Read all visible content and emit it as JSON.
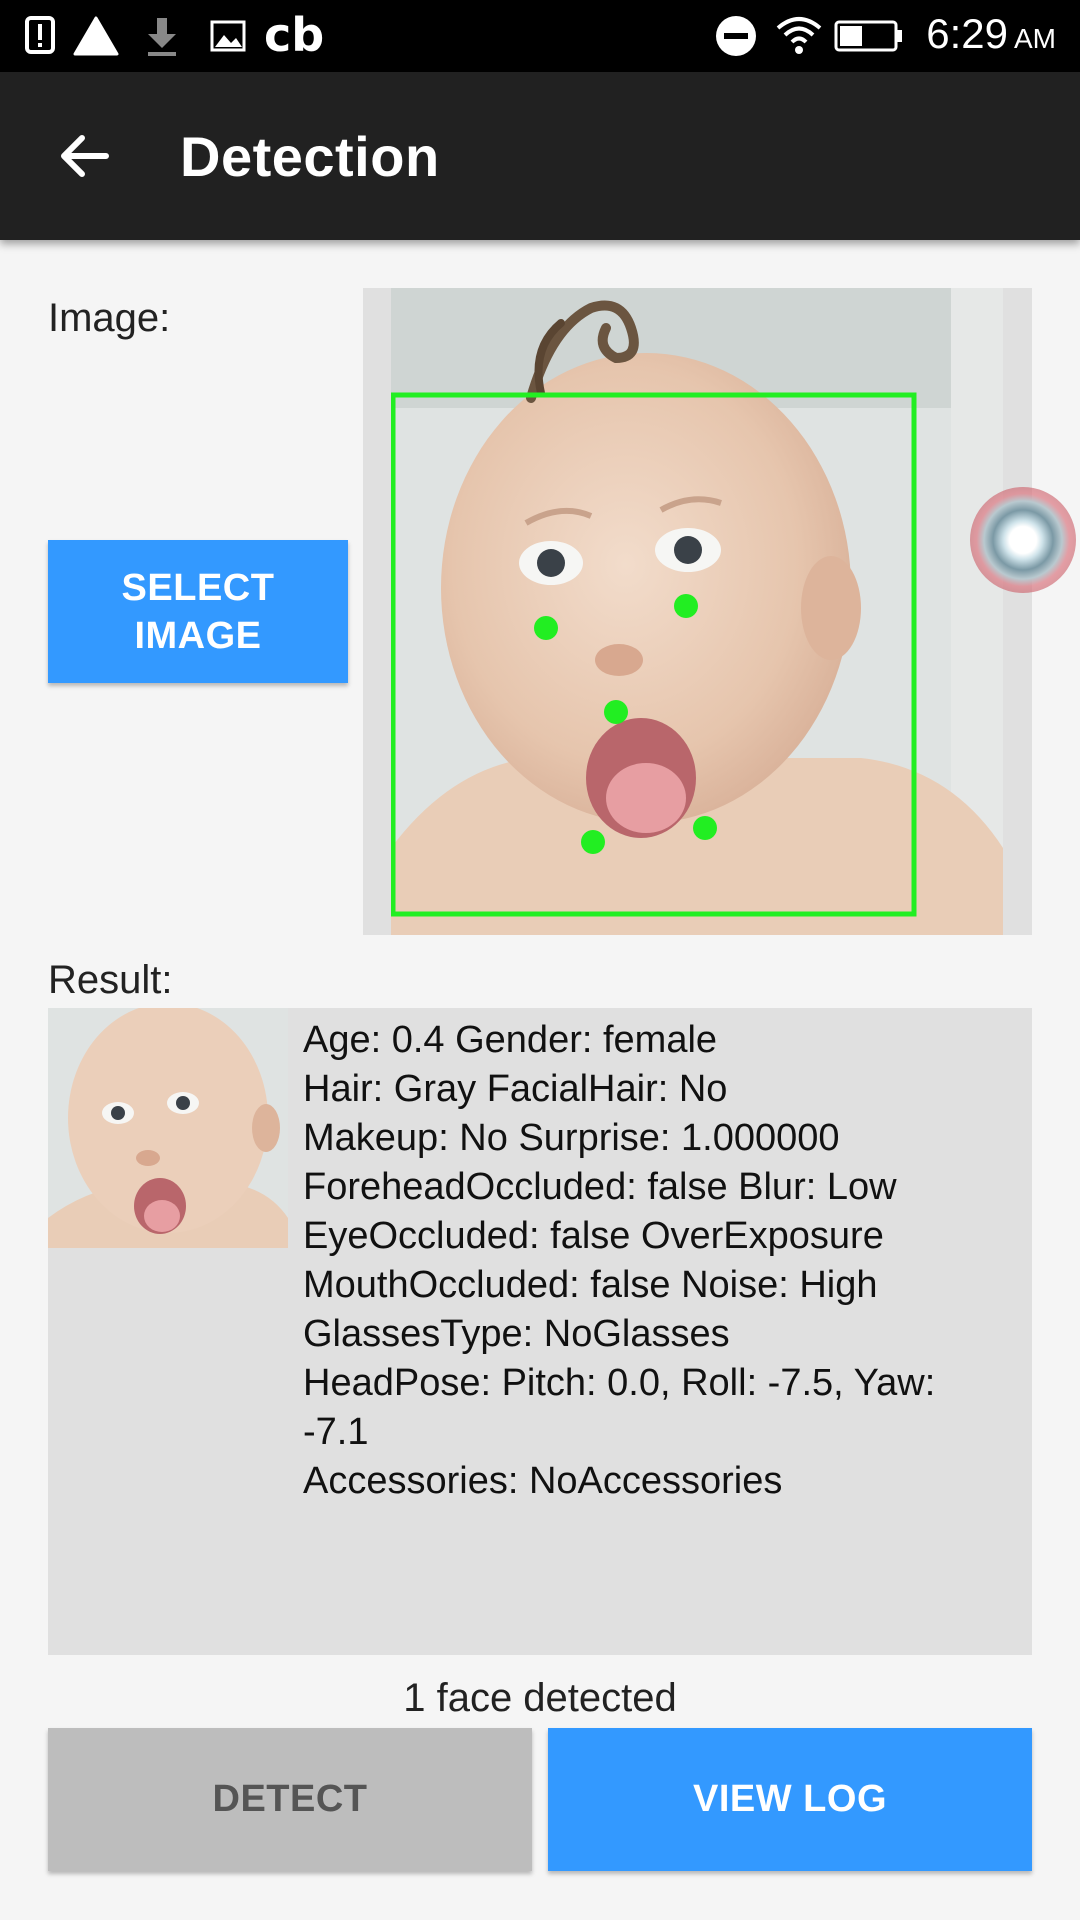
{
  "status_bar": {
    "time": "6:29",
    "ampm": "AM",
    "notification_icons": [
      "alert-icon",
      "triangle-icon",
      "download-icon",
      "image-icon"
    ],
    "app_icon_text": "cb",
    "right_icons": [
      "dnd-icon",
      "wifi-icon",
      "battery-icon"
    ]
  },
  "app_bar": {
    "title": "Detection",
    "back_icon": "arrow-left-icon"
  },
  "image_section": {
    "label": "Image:",
    "select_button": "SELECT\nIMAGE"
  },
  "result_section": {
    "label": "Result:",
    "lines": [
      "Age: 0.4  Gender: female",
      "Hair: Gray  FacialHair: No",
      "Makeup: No  Surprise: 1.000000",
      "ForeheadOccluded: false  Blur: Low",
      "EyeOccluded: false  OverExposure",
      "MouthOccluded: false  Noise: High",
      "GlassesType: NoGlasses",
      "HeadPose: Pitch: 0.0, Roll: -7.5, Yaw:",
      "-7.1",
      "Accessories: NoAccessories"
    ]
  },
  "status_text": "1 face detected",
  "buttons": {
    "detect": "DETECT",
    "view_log": "VIEW LOG"
  },
  "colors": {
    "accent": "#3399ff",
    "app_bar": "#212121",
    "face_box": "#22ee22",
    "disabled_button": "#bdbdbd"
  }
}
